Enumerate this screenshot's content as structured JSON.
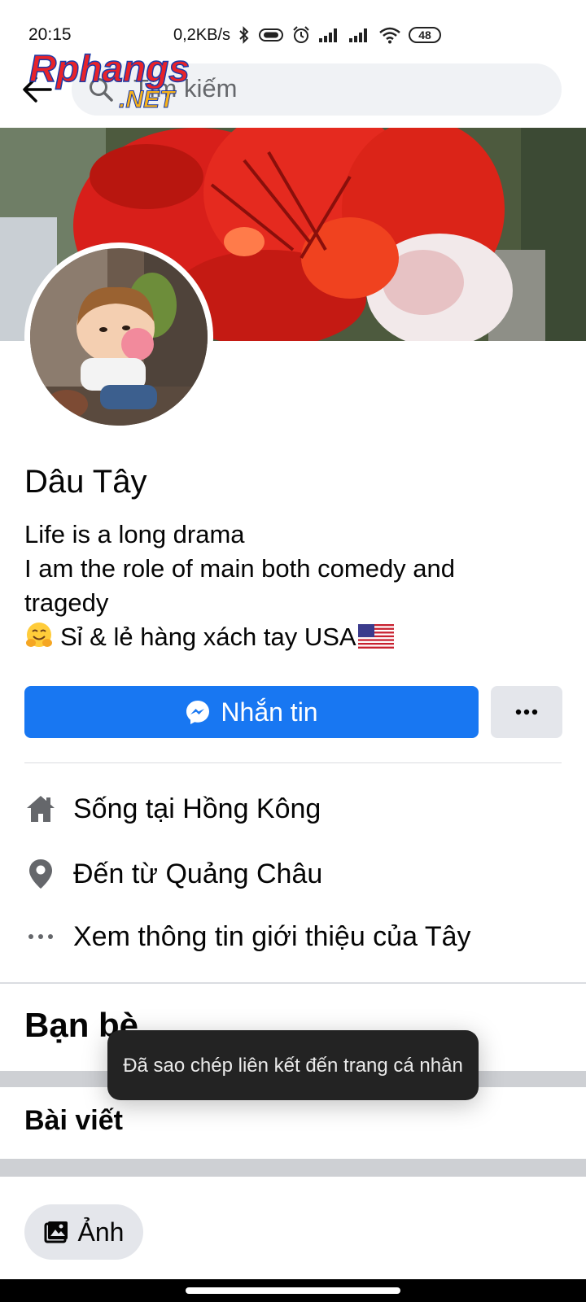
{
  "status_bar": {
    "time": "20:15",
    "network_speed": "0,2KB/s",
    "battery_level": "48",
    "icons": [
      "bluetooth-icon",
      "vibrate-icon",
      "alarm-icon",
      "signal-icon",
      "signal-icon",
      "wifi-icon",
      "battery-icon"
    ]
  },
  "watermark": {
    "text": "Rphangs",
    "suffix": ".NET"
  },
  "header": {
    "search_placeholder": "Tìm kiếm",
    "back_icon": "back-arrow-icon",
    "search_icon": "search-icon"
  },
  "profile": {
    "name": "Dâu Tây",
    "bio": {
      "line1": "Life is a long drama",
      "line2": "I am the role of main both comedy and",
      "line3": "tragedy",
      "line4": "Sỉ & lẻ hàng xách tay USA"
    }
  },
  "actions": {
    "message_label": "Nhắn tin",
    "message_icon": "messenger-icon",
    "more_icon": "more-dots-icon"
  },
  "intro": {
    "lives_in": "Sống tại Hồng Kông",
    "from": "Đến từ Quảng Châu",
    "see_more": "Xem thông tin giới thiệu của Tây"
  },
  "sections": {
    "friends": "Bạn bè",
    "posts": "Bài viết"
  },
  "toast": {
    "message": "Đã sao chép liên kết đến trang cá nhân"
  },
  "photos_chip": {
    "label": "Ảnh",
    "icon": "photos-icon"
  },
  "colors": {
    "primary": "#1877f2",
    "search_bg": "#f0f2f5",
    "secondary_button": "#e4e6eb",
    "separator": "#ced0d4",
    "toast_bg": "#232323"
  }
}
